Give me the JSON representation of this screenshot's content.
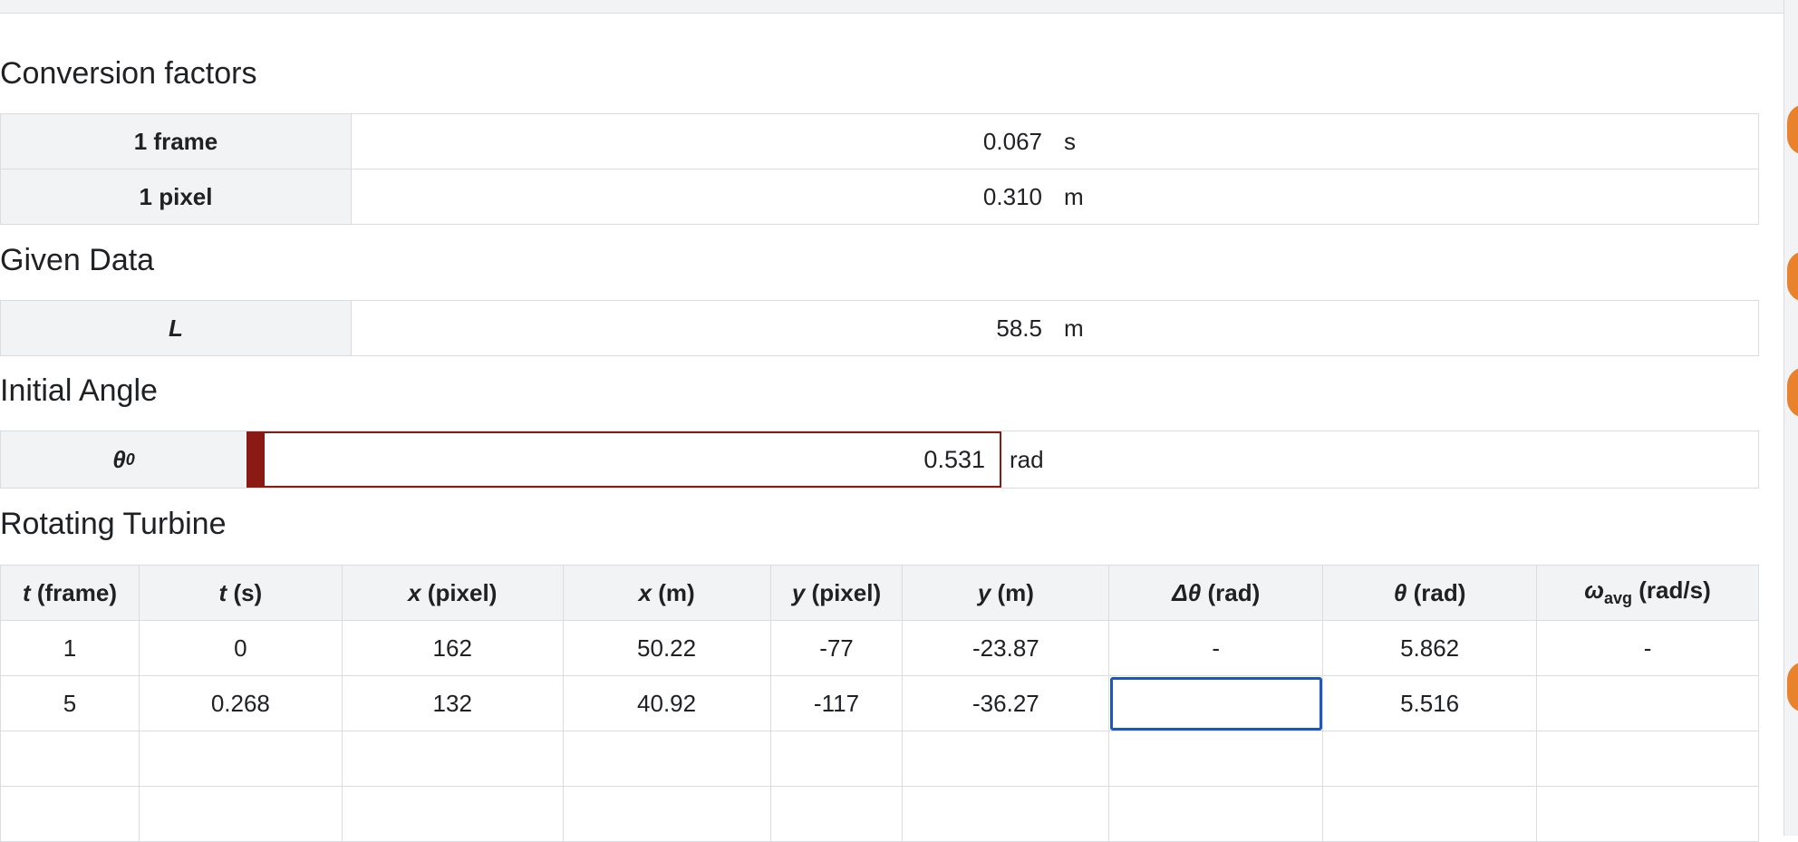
{
  "conversion": {
    "title": "Conversion factors",
    "rows": [
      {
        "label": "1 frame",
        "value": "0.067",
        "unit": "s"
      },
      {
        "label": "1 pixel",
        "value": "0.310",
        "unit": "m"
      }
    ]
  },
  "given": {
    "title": "Given Data",
    "rows": [
      {
        "label": "L",
        "value": "58.5",
        "unit": "m"
      }
    ]
  },
  "initial": {
    "title": "Initial Angle",
    "label": "θ",
    "label_sub": "0",
    "value": "0.531",
    "unit": "rad"
  },
  "turbine": {
    "title": "Rotating Turbine",
    "columns": [
      {
        "var": "t",
        "unit": "(frame)"
      },
      {
        "var": "t",
        "unit": "(s)"
      },
      {
        "var": "x",
        "unit": "(pixel)"
      },
      {
        "var": "x",
        "unit": "(m)"
      },
      {
        "var": "y",
        "unit": "(pixel)"
      },
      {
        "var": "y",
        "unit": "(m)"
      },
      {
        "var": "Δθ",
        "unit": "(rad)"
      },
      {
        "var": "θ",
        "unit": "(rad)"
      },
      {
        "var": "ω",
        "sub": "avg",
        "unit": "(rad/s)"
      }
    ],
    "rows": [
      [
        "1",
        "0",
        "162",
        "50.22",
        "-77",
        "-23.87",
        "-",
        "5.862",
        "-"
      ],
      [
        "5",
        "0.268",
        "132",
        "40.92",
        "-117",
        "-36.27",
        "",
        "5.516",
        ""
      ],
      [
        "",
        "",
        "",
        "",
        "",
        "",
        "",
        "",
        ""
      ],
      [
        "",
        "",
        "",
        "",
        "",
        "",
        "",
        "",
        ""
      ]
    ],
    "active_cell": {
      "row": 1,
      "col": 6
    }
  }
}
